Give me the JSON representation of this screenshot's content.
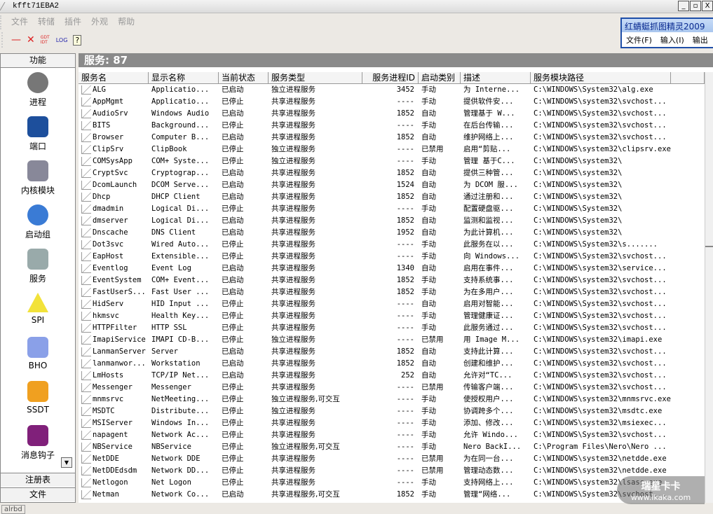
{
  "window": {
    "title": "kfft71EBA2",
    "min": "_",
    "restore": "▫",
    "close": "X"
  },
  "menu": [
    "文件",
    "转储",
    "插件",
    "外观",
    "帮助"
  ],
  "toolbar": {
    "minus": "—",
    "delete": "✕",
    "gdt": "GDT IDT",
    "log": "LOG",
    "help": "?"
  },
  "popup": {
    "title": "红蜻蜓抓图精灵2009",
    "menus": [
      "文件(F)",
      "输入(I)",
      "输出"
    ]
  },
  "sidebar": {
    "header": "功能",
    "items": [
      {
        "label": "进程",
        "icon": "gear-icon",
        "color": "#777"
      },
      {
        "label": "端口",
        "icon": "port-icon",
        "color": "#1d4f9c"
      },
      {
        "label": "内核模块",
        "icon": "drive-icon",
        "color": "#889"
      },
      {
        "label": "启动组",
        "icon": "globe-icon",
        "color": "#3a7bd5"
      },
      {
        "label": "服务",
        "icon": "computer-icon",
        "color": "#9aa"
      },
      {
        "label": "SPI",
        "icon": "warning-icon",
        "color": "#f2e23a"
      },
      {
        "label": "BHO",
        "icon": "folder-icon",
        "color": "#8aa0e8"
      },
      {
        "label": "SSDT",
        "icon": "bell-icon",
        "color": "#f0a020"
      },
      {
        "label": "消息钩子",
        "icon": "hook-icon",
        "color": "#80207a"
      }
    ],
    "bottom": [
      "注册表",
      "文件"
    ]
  },
  "main": {
    "title": "服务: 87",
    "columns": [
      "服务名",
      "显示名称",
      "当前状态",
      "服务类型",
      "服务进程ID",
      "启动类别",
      "描述",
      "服务模块路径"
    ],
    "rows": [
      [
        "ALG",
        "Applicatio...",
        "已启动",
        "独立进程服务",
        "3452",
        "手动",
        "为 Interne...",
        "C:\\WINDOWS\\System32\\alg.exe"
      ],
      [
        "AppMgmt",
        "Applicatio...",
        "已停止",
        "共享进程服务",
        "----",
        "手动",
        "提供软件安...",
        "C:\\WINDOWS\\system32\\svchost..."
      ],
      [
        "AudioSrv",
        "Windows Audio",
        "已启动",
        "共享进程服务",
        "1852",
        "自动",
        "管理基于 W...",
        "C:\\WINDOWS\\System32\\svchost..."
      ],
      [
        "BITS",
        "Background...",
        "已停止",
        "共享进程服务",
        "----",
        "手动",
        "在后台传输...",
        "C:\\WINDOWS\\system32\\svchost..."
      ],
      [
        "Browser",
        "Computer B...",
        "已启动",
        "共享进程服务",
        "1852",
        "自动",
        "维护网络上...",
        "C:\\WINDOWS\\system32\\svchost..."
      ],
      [
        "ClipSrv",
        "ClipBook",
        "已停止",
        "独立进程服务",
        "----",
        "已禁用",
        "启用“剪贴...",
        "C:\\WINDOWS\\system32\\clipsrv.exe"
      ],
      [
        "COMSysApp",
        "COM+ Syste...",
        "已停止",
        "独立进程服务",
        "----",
        "手动",
        "管理 基于C...",
        "C:\\WINDOWS\\system32\\"
      ],
      [
        "CryptSvc",
        "Cryptograp...",
        "已启动",
        "共享进程服务",
        "1852",
        "自动",
        "提供三种管...",
        "C:\\WINDOWS\\system32\\"
      ],
      [
        "DcomLaunch",
        "DCOM Serve...",
        "已启动",
        "共享进程服务",
        "1524",
        "自动",
        "为 DCOM 服...",
        "C:\\WINDOWS\\system32\\"
      ],
      [
        "Dhcp",
        "DHCP Client",
        "已启动",
        "共享进程服务",
        "1852",
        "自动",
        "通过注册和...",
        "C:\\WINDOWS\\system32\\"
      ],
      [
        "dmadmin",
        "Logical Di...",
        "已停止",
        "共享进程服务",
        "----",
        "手动",
        "配置硬盘驱...",
        "C:\\WINDOWS\\System32\\"
      ],
      [
        "dmserver",
        "Logical Di...",
        "已启动",
        "共享进程服务",
        "1852",
        "自动",
        "监测和监视...",
        "C:\\WINDOWS\\System32\\"
      ],
      [
        "Dnscache",
        "DNS Client",
        "已启动",
        "共享进程服务",
        "1952",
        "自动",
        "为此计算机...",
        "C:\\WINDOWS\\system32\\"
      ],
      [
        "Dot3svc",
        "Wired Auto...",
        "已停止",
        "共享进程服务",
        "----",
        "手动",
        "此服务在以...",
        "C:\\WINDOWS\\System32\\s......."
      ],
      [
        "EapHost",
        "Extensible...",
        "已停止",
        "共享进程服务",
        "----",
        "手动",
        "向 Windows...",
        "C:\\WINDOWS\\System32\\svchost..."
      ],
      [
        "Eventlog",
        "Event Log",
        "已启动",
        "共享进程服务",
        "1340",
        "自动",
        "启用在事件...",
        "C:\\WINDOWS\\system32\\service..."
      ],
      [
        "EventSystem",
        "COM+ Event...",
        "已启动",
        "共享进程服务",
        "1852",
        "手动",
        "支持系统事...",
        "C:\\WINDOWS\\system32\\svchost..."
      ],
      [
        "FastUserS...",
        "Fast User ...",
        "已启动",
        "共享进程服务",
        "1852",
        "手动",
        "为在多用户...",
        "C:\\WINDOWS\\System32\\svchost..."
      ],
      [
        "HidServ",
        "HID Input ...",
        "已停止",
        "共享进程服务",
        "----",
        "自动",
        "启用对智能...",
        "C:\\WINDOWS\\System32\\svchost..."
      ],
      [
        "hkmsvc",
        "Health Key...",
        "已停止",
        "共享进程服务",
        "----",
        "手动",
        "管理健康证...",
        "C:\\WINDOWS\\System32\\svchost..."
      ],
      [
        "HTTPFilter",
        "HTTP SSL",
        "已停止",
        "共享进程服务",
        "----",
        "手动",
        "此服务通过...",
        "C:\\WINDOWS\\System32\\svchost..."
      ],
      [
        "ImapiService",
        "IMAPI CD-B...",
        "已停止",
        "独立进程服务",
        "----",
        "已禁用",
        "用 Image M...",
        "C:\\WINDOWS\\system32\\imapi.exe"
      ],
      [
        "LanmanServer",
        "Server",
        "已启动",
        "共享进程服务",
        "1852",
        "自动",
        "支持此计算...",
        "C:\\WINDOWS\\system32\\svchost..."
      ],
      [
        "lanmanwor...",
        "Workstation",
        "已启动",
        "共享进程服务",
        "1852",
        "自动",
        "创建和维护...",
        "C:\\WINDOWS\\system32\\svchost..."
      ],
      [
        "LmHosts",
        "TCP/IP Net...",
        "已启动",
        "共享进程服务",
        "252",
        "自动",
        "允许对“TC...",
        "C:\\WINDOWS\\system32\\svchost..."
      ],
      [
        "Messenger",
        "Messenger",
        "已停止",
        "共享进程服务",
        "----",
        "已禁用",
        "传输客户端...",
        "C:\\WINDOWS\\system32\\svchost..."
      ],
      [
        "mnmsrvc",
        "NetMeeting...",
        "已停止",
        "独立进程服务,可交互",
        "----",
        "手动",
        "使授权用户...",
        "C:\\WINDOWS\\system32\\mnmsrvc.exe"
      ],
      [
        "MSDTC",
        "Distribute...",
        "已停止",
        "独立进程服务",
        "----",
        "手动",
        "协调跨多个...",
        "C:\\WINDOWS\\system32\\msdtc.exe"
      ],
      [
        "MSIServer",
        "Windows In...",
        "已停止",
        "共享进程服务",
        "----",
        "手动",
        "添加、修改...",
        "C:\\WINDOWS\\system32\\msiexec..."
      ],
      [
        "napagent",
        "Network Ac...",
        "已停止",
        "共享进程服务",
        "----",
        "手动",
        "允许 Windo...",
        "C:\\WINDOWS\\System32\\svchost..."
      ],
      [
        "NBService",
        "NBService",
        "已停止",
        "独立进程服务,可交互",
        "----",
        "手动",
        "Nero BackI...",
        "C:\\Program Files\\Nero\\Nero ..."
      ],
      [
        "NetDDE",
        "Network DDE",
        "已停止",
        "共享进程服务",
        "----",
        "已禁用",
        "为在同一台...",
        "C:\\WINDOWS\\system32\\netdde.exe"
      ],
      [
        "NetDDEdsdm",
        "Network DD...",
        "已停止",
        "共享进程服务",
        "----",
        "已禁用",
        "管理动态数...",
        "C:\\WINDOWS\\system32\\netdde.exe"
      ],
      [
        "Netlogon",
        "Net Logon",
        "已停止",
        "共享进程服务",
        "----",
        "手动",
        "支持网络上...",
        "C:\\WINDOWS\\system32\\lsass.exe"
      ],
      [
        "Netman",
        "Network Co...",
        "已启动",
        "共享进程服务,可交互",
        "1852",
        "手动",
        "管理“网络...",
        "C:\\WINDOWS\\System32\\svchost..."
      ]
    ]
  },
  "status": "alrbd",
  "watermark": {
    "name": "瑞星卡卡",
    "url": "www.ikaka.com"
  }
}
